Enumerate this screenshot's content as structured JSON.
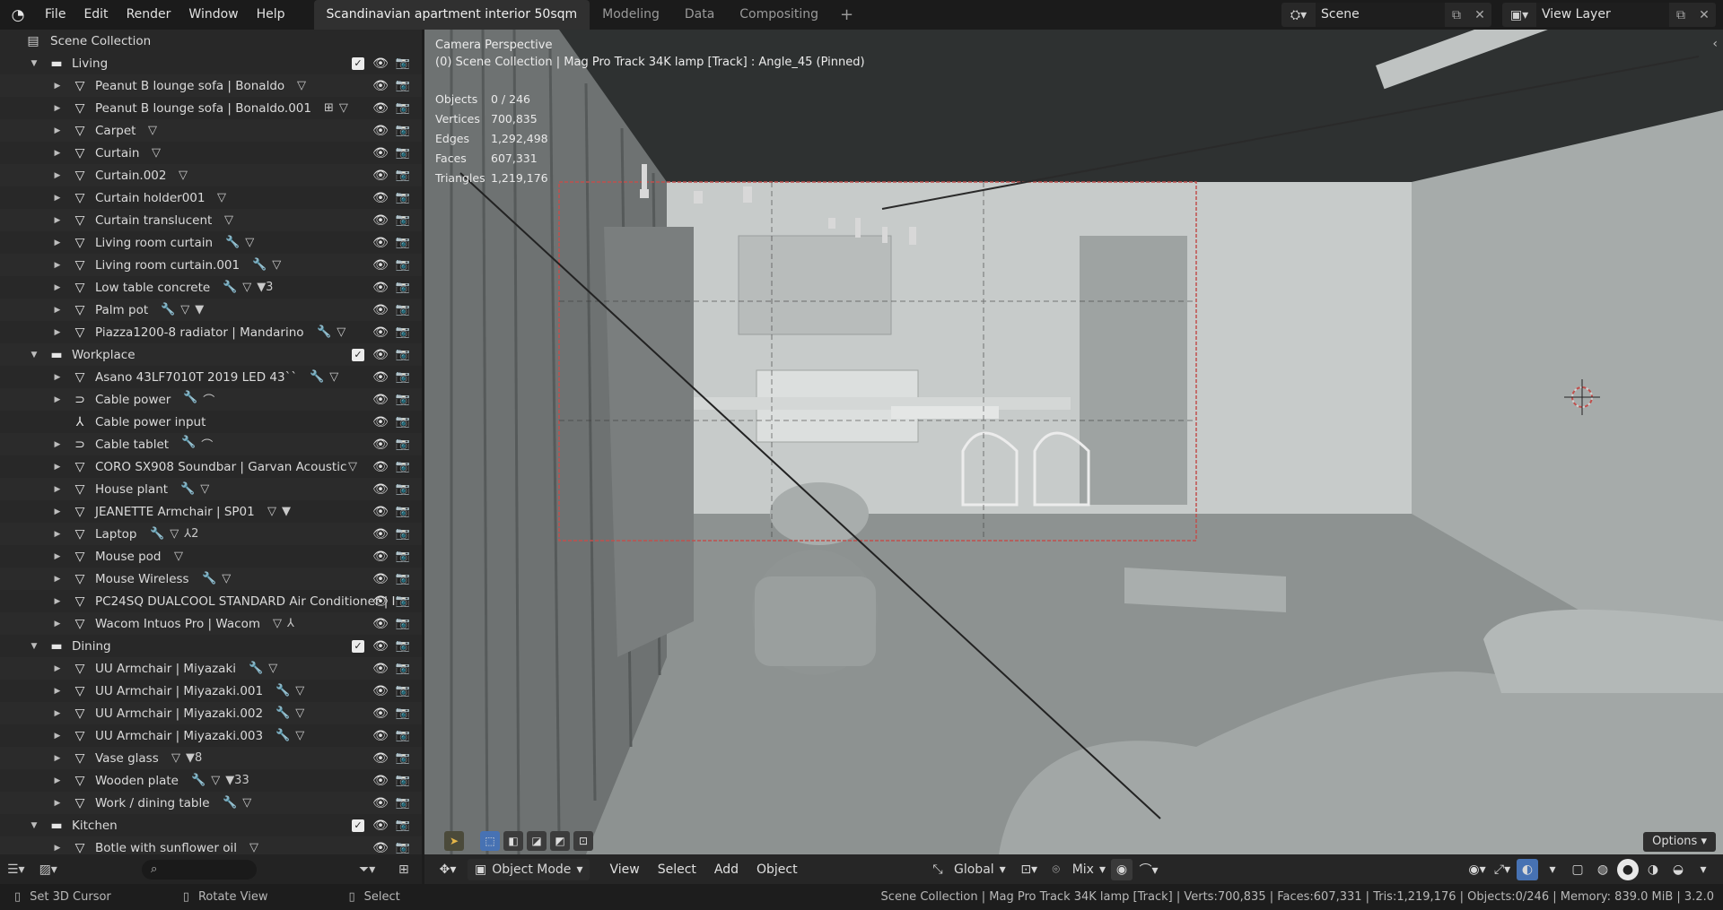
{
  "app": {
    "menu": [
      "File",
      "Edit",
      "Render",
      "Window",
      "Help"
    ],
    "workspaces": [
      "Scandinavian apartment interior 50sqm",
      "Modeling",
      "Data",
      "Compositing"
    ],
    "active_workspace": 0,
    "scene": "Scene",
    "view_layer": "View Layer"
  },
  "outliner": {
    "root": "Scene Collection",
    "rows": [
      {
        "type": "collection",
        "label": "Living"
      },
      {
        "type": "object",
        "label": "Peanut B  lounge sofa | Bonaldo",
        "mods": [
          "▽"
        ]
      },
      {
        "type": "object",
        "label": "Peanut B  lounge sofa | Bonaldo.001",
        "mods": [
          "⊞",
          "▽"
        ]
      },
      {
        "type": "object",
        "label": "Carpet",
        "mods": [
          "▽"
        ]
      },
      {
        "type": "object",
        "label": "Curtain",
        "mods": [
          "▽"
        ]
      },
      {
        "type": "object",
        "label": "Curtain.002",
        "mods": [
          "▽"
        ]
      },
      {
        "type": "object",
        "label": "Curtain holder001",
        "mods": [
          "▽"
        ]
      },
      {
        "type": "object",
        "label": "Curtain translucent",
        "mods": [
          "▽"
        ]
      },
      {
        "type": "object",
        "label": "Living room curtain",
        "mods": [
          "🔧",
          "▽"
        ]
      },
      {
        "type": "object",
        "label": "Living room curtain.001",
        "mods": [
          "🔧",
          "▽"
        ]
      },
      {
        "type": "object",
        "label": "Low table concrete",
        "mods": [
          "🔧",
          "▽",
          "▼3"
        ]
      },
      {
        "type": "object",
        "label": "Palm pot",
        "mods": [
          "🔧",
          "▽",
          "▼"
        ]
      },
      {
        "type": "object",
        "label": "Piazza1200-8 radiator | Mandarino",
        "mods": [
          "🔧",
          "▽"
        ]
      },
      {
        "type": "collection",
        "label": "Workplace"
      },
      {
        "type": "object",
        "label": "Asano 43LF7010T 2019 LED 43``",
        "mods": [
          "🔧",
          "▽"
        ]
      },
      {
        "type": "curve",
        "label": "Cable power",
        "mods": [
          "🔧",
          "⌒"
        ]
      },
      {
        "type": "empty",
        "label": "Cable power input",
        "mods": []
      },
      {
        "type": "curve",
        "label": "Cable tablet",
        "mods": [
          "🔧",
          "⌒"
        ]
      },
      {
        "type": "object",
        "label": "CORO SX908 Soundbar | Garvan Acoustic",
        "mods": [
          "▽"
        ]
      },
      {
        "type": "object",
        "label": "House plant",
        "mods": [
          "🔧",
          "▽"
        ]
      },
      {
        "type": "object",
        "label": "JEANETTE Armchair  | SP01",
        "mods": [
          "▽",
          "▼"
        ]
      },
      {
        "type": "object",
        "label": "Laptop",
        "mods": [
          "🔧",
          "▽",
          "⅄2"
        ]
      },
      {
        "type": "object",
        "label": "Mouse pod",
        "mods": [
          "▽"
        ]
      },
      {
        "type": "object",
        "label": "Mouse Wireless",
        "mods": [
          "🔧",
          "▽"
        ]
      },
      {
        "type": "object",
        "label": "PC24SQ DUALCOOL STANDARD Air Conditioner | I",
        "mods": []
      },
      {
        "type": "object",
        "label": "Wacom Intuos Pro | Wacom",
        "mods": [
          "▽",
          "⅄"
        ]
      },
      {
        "type": "collection",
        "label": "Dining"
      },
      {
        "type": "object",
        "label": "UU Armchair | Miyazaki",
        "mods": [
          "🔧",
          "▽"
        ]
      },
      {
        "type": "object",
        "label": "UU Armchair | Miyazaki.001",
        "mods": [
          "🔧",
          "▽"
        ]
      },
      {
        "type": "object",
        "label": "UU Armchair | Miyazaki.002",
        "mods": [
          "🔧",
          "▽"
        ]
      },
      {
        "type": "object",
        "label": "UU Armchair | Miyazaki.003",
        "mods": [
          "🔧",
          "▽"
        ]
      },
      {
        "type": "object",
        "label": "Vase glass",
        "mods": [
          "▽",
          "▼8"
        ]
      },
      {
        "type": "object",
        "label": "Wooden plate",
        "mods": [
          "🔧",
          "▽",
          "▼33"
        ]
      },
      {
        "type": "object",
        "label": "Work / dining table",
        "mods": [
          "🔧",
          "▽"
        ]
      },
      {
        "type": "collection",
        "label": "Kitchen"
      },
      {
        "type": "object",
        "label": "Botle with sunflower oil",
        "mods": [
          "▽"
        ]
      }
    ]
  },
  "viewport": {
    "view_name": "Camera Perspective",
    "camera_line": "(0) Scene Collection | Mag Pro Track 34K lamp [Track] : Angle_45 (Pinned)",
    "stats": [
      {
        "k": "Objects",
        "v": "0 / 246"
      },
      {
        "k": "Vertices",
        "v": "700,835"
      },
      {
        "k": "Edges",
        "v": "1,292,498"
      },
      {
        "k": "Faces",
        "v": "607,331"
      },
      {
        "k": "Triangles",
        "v": "1,219,176"
      }
    ],
    "options": "Options"
  },
  "viewport_header": {
    "mode": "Object Mode",
    "menus": [
      "View",
      "Select",
      "Add",
      "Object"
    ],
    "orientation": "Global",
    "snap_mode": "Mix"
  },
  "statusbar": {
    "left": [
      "Set 3D Cursor",
      "Rotate View",
      "Select"
    ],
    "right": "Scene Collection | Mag Pro Track 34K lamp [Track] | Verts:700,835 | Faces:607,331 | Tris:1,219,176 | Objects:0/246 | Memory: 839.0 MiB | 3.2.0"
  },
  "colors": {
    "accent": "#4772b3",
    "camera_frame": "#c0504d"
  }
}
